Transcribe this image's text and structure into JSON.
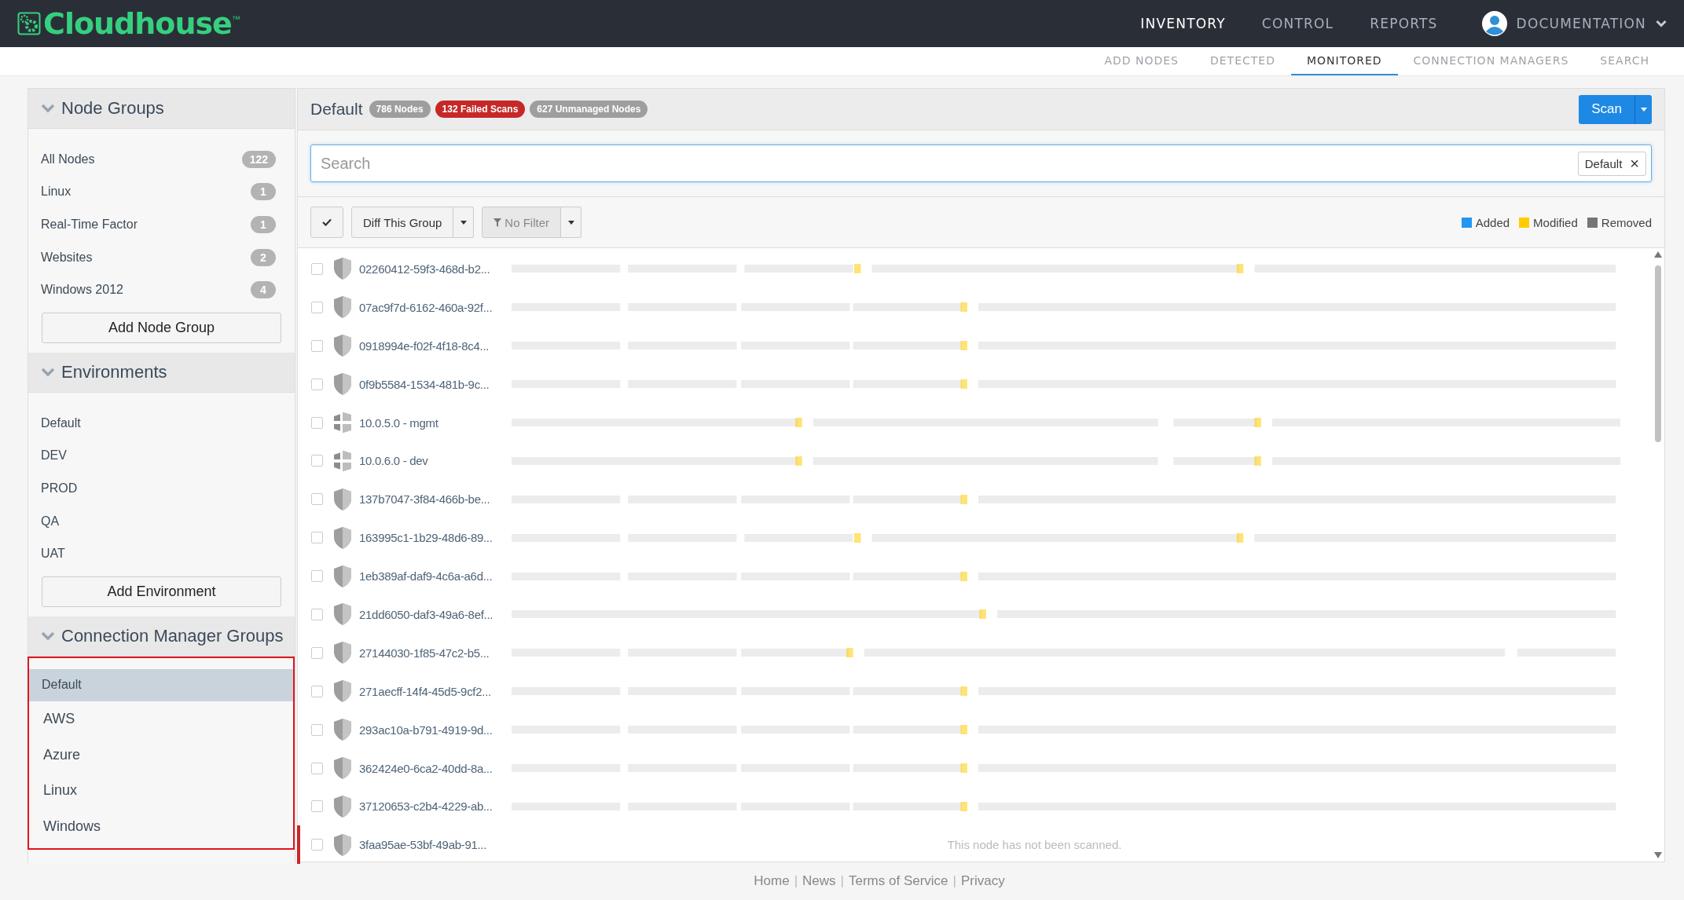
{
  "header": {
    "logo": "Cloudhouse",
    "trademark": "™",
    "nav": [
      {
        "label": "INVENTORY",
        "selected": true
      },
      {
        "label": "CONTROL",
        "selected": false
      },
      {
        "label": "REPORTS",
        "selected": false
      }
    ],
    "user": "DOCUMENTATION"
  },
  "subnav": [
    {
      "label": "ADD NODES",
      "selected": false
    },
    {
      "label": "DETECTED",
      "selected": false
    },
    {
      "label": "MONITORED",
      "selected": true
    },
    {
      "label": "CONNECTION MANAGERS",
      "selected": false
    },
    {
      "label": "SEARCH",
      "selected": false
    }
  ],
  "sidebar": {
    "sections": [
      {
        "title": "Node Groups",
        "expanded": true,
        "button": "Add Node Group",
        "items": [
          {
            "label": "All Nodes",
            "count": "122",
            "selected": false
          },
          {
            "label": "Linux",
            "count": "1",
            "selected": false
          },
          {
            "label": "Real-Time Factor",
            "count": "1",
            "selected": false
          },
          {
            "label": "Websites",
            "count": "2",
            "selected": false
          },
          {
            "label": "Windows 2012",
            "count": "4",
            "selected": false
          }
        ]
      },
      {
        "title": "Environments",
        "expanded": true,
        "button": "Add Environment",
        "items": [
          {
            "label": "Default",
            "selected": false
          },
          {
            "label": "DEV",
            "selected": false
          },
          {
            "label": "PROD",
            "selected": false
          },
          {
            "label": "QA",
            "selected": false
          },
          {
            "label": "UAT",
            "selected": false
          }
        ]
      },
      {
        "title": "Connection Manager Groups",
        "expanded": true,
        "highlighted": true,
        "items": [
          {
            "label": "Default",
            "selected": true
          },
          {
            "label": "AWS",
            "selected": false
          },
          {
            "label": "Azure",
            "selected": false
          },
          {
            "label": "Linux",
            "selected": false
          },
          {
            "label": "Windows",
            "selected": false
          }
        ]
      }
    ]
  },
  "main": {
    "title": "Default",
    "badges": [
      {
        "label": "786 Nodes",
        "color": "#9e9e9e"
      },
      {
        "label": "132 Failed Scans",
        "color": "#c62828"
      },
      {
        "label": "627 Unmanaged Nodes",
        "color": "#9e9e9e"
      }
    ],
    "scan_button": "Scan",
    "search": {
      "placeholder": "Search",
      "tag": "Default",
      "tag_close": "×"
    },
    "toolbar": {
      "diff_button": "Diff This Group",
      "filter_button": "No Filter"
    },
    "legend": [
      {
        "label": "Added",
        "color": "#2196f3"
      },
      {
        "label": "Modified",
        "color": "#ffcc00"
      },
      {
        "label": "Removed",
        "color": "#757575"
      }
    ],
    "nodes": [
      {
        "name": "02260412-59f3-468d-b2...",
        "kind": "shield",
        "checked": false,
        "failed": false
      },
      {
        "name": "07ac9f7d-6162-460a-92f...",
        "kind": "shield",
        "checked": false,
        "failed": false
      },
      {
        "name": "0918994e-f02f-4f18-8c4...",
        "kind": "shield",
        "checked": false,
        "failed": false
      },
      {
        "name": "0f9b5584-1534-481b-9c...",
        "kind": "shield",
        "checked": false,
        "failed": false
      },
      {
        "name": "10.0.5.0 - mgmt",
        "kind": "network",
        "checked": false,
        "failed": false
      },
      {
        "name": "10.0.6.0 - dev",
        "kind": "network",
        "checked": false,
        "failed": false
      },
      {
        "name": "137b7047-3f84-466b-be...",
        "kind": "shield",
        "checked": false,
        "failed": false
      },
      {
        "name": "163995c1-1b29-48d6-89...",
        "kind": "shield",
        "checked": false,
        "failed": false
      },
      {
        "name": "1eb389af-daf9-4c6a-a6d...",
        "kind": "shield",
        "checked": false,
        "failed": false
      },
      {
        "name": "21dd6050-daf3-49a6-8ef...",
        "kind": "shield",
        "checked": false,
        "failed": false
      },
      {
        "name": "27144030-1f85-47c2-b5...",
        "kind": "shield",
        "checked": false,
        "failed": false
      },
      {
        "name": "271aecff-14f4-45d5-9cf2...",
        "kind": "shield",
        "checked": false,
        "failed": false
      },
      {
        "name": "293ac10a-b791-4919-9d...",
        "kind": "shield",
        "checked": false,
        "failed": false
      },
      {
        "name": "362424e0-6ca2-40dd-8a...",
        "kind": "shield",
        "checked": false,
        "failed": false
      },
      {
        "name": "37120653-c2b4-4229-ab...",
        "kind": "shield",
        "checked": false,
        "failed": false
      },
      {
        "name": "3faa95ae-53bf-49ab-91...",
        "kind": "shield",
        "checked": false,
        "failed": true,
        "message": "This node has not been scanned."
      }
    ]
  },
  "footer": {
    "links": [
      "Home",
      "News",
      "Terms of Service",
      "Privacy"
    ],
    "separator": "|"
  }
}
